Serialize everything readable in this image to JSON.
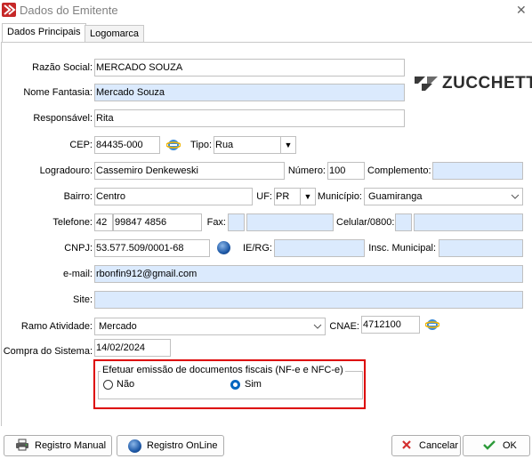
{
  "window": {
    "title": "Dados do Emitente",
    "close_glyph": "✕"
  },
  "tabs": [
    "Dados Principais",
    "Logomarca"
  ],
  "logo_text": "ZUCCHETTI",
  "form": {
    "razao_social": {
      "label": "Razão Social:",
      "value": "MERCADO SOUZA"
    },
    "nome_fantasia": {
      "label": "Nome Fantasia:",
      "value": "Mercado Souza"
    },
    "responsavel": {
      "label": "Responsável:",
      "value": "Rita"
    },
    "cep": {
      "label": "CEP:",
      "value": "84435-000"
    },
    "tipo": {
      "label": "Tipo:",
      "value": "Rua"
    },
    "logradouro": {
      "label": "Logradouro:",
      "value": "Cassemiro Denkeweski"
    },
    "numero": {
      "label": "Número:",
      "value": "100"
    },
    "complemento": {
      "label": "Complemento:",
      "value": ""
    },
    "bairro": {
      "label": "Bairro:",
      "value": "Centro"
    },
    "uf": {
      "label": "UF:",
      "value": "PR"
    },
    "municipio": {
      "label": "Município:",
      "value": "Guamiranga"
    },
    "telefone": {
      "label": "Telefone:",
      "ddd": "42",
      "value": "99847 4856"
    },
    "fax": {
      "label": "Fax:",
      "ddd": "",
      "value": ""
    },
    "celular": {
      "label": "Celular/0800:",
      "ddd": "",
      "value": ""
    },
    "cnpj": {
      "label": "CNPJ:",
      "value": "53.577.509/0001-68"
    },
    "ie_rg": {
      "label": "IE/RG:",
      "value": ""
    },
    "insc_municipal": {
      "label": "Insc. Municipal:",
      "value": ""
    },
    "email": {
      "label": "e-mail:",
      "value": "rbonfin912@gmail.com"
    },
    "site": {
      "label": "Site:",
      "value": ""
    },
    "ramo_atividade": {
      "label": "Ramo Atividade:",
      "value": "Mercado"
    },
    "cnae": {
      "label": "CNAE:",
      "value": "4712100"
    },
    "compra_sistema": {
      "label": "Compra do Sistema:",
      "value": "14/02/2024"
    }
  },
  "fiscal_group": {
    "legend": "Efetuar emissão de documentos fiscais (NF-e e NFC-e)",
    "option_no": "Não",
    "option_yes": "Sim",
    "selected": "Sim"
  },
  "buttons": {
    "registro_manual": "Registro Manual",
    "registro_online": "Registro OnLine",
    "cancelar": "Cancelar",
    "ok": "OK"
  },
  "colors": {
    "field_blue": "#dbeafd",
    "highlight_red": "#dd0000",
    "ok_green": "#2e9b3b",
    "cancel_red": "#d32f2f"
  }
}
